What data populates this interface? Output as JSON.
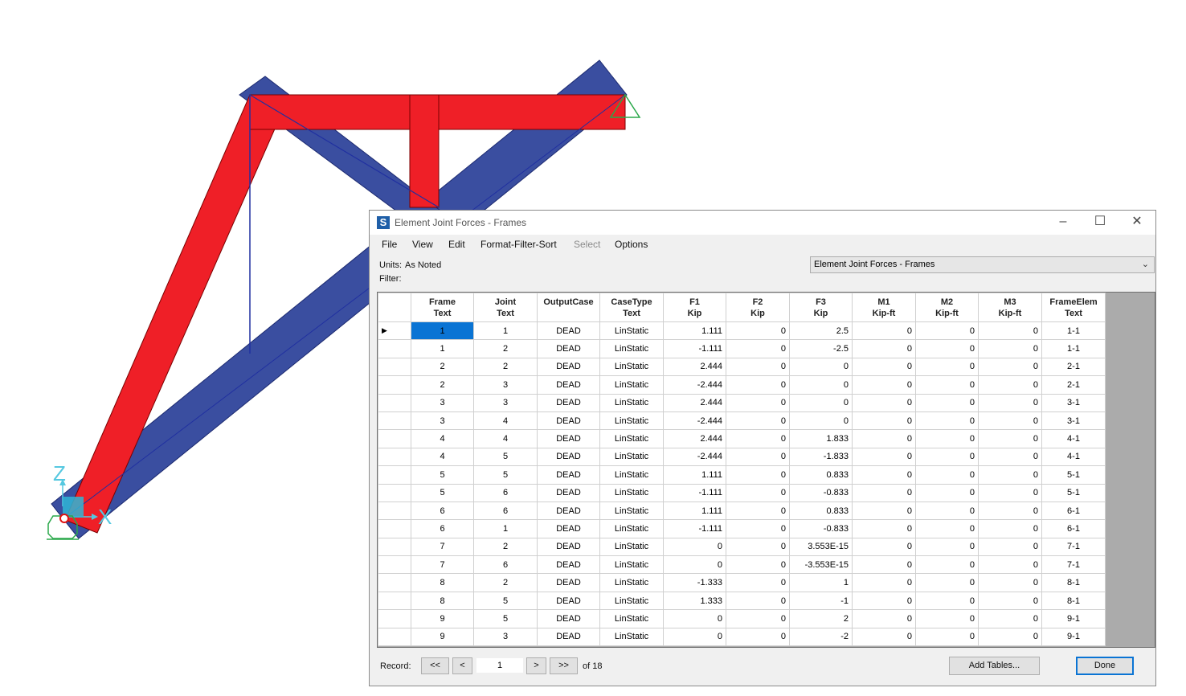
{
  "model_view": {
    "axis_z_label": "Z",
    "axis_x_label": "X"
  },
  "window": {
    "title": "Element Joint Forces - Frames",
    "app_icon": "S",
    "minimize_icon": "minimize-icon",
    "maximize_icon": "maximize-icon",
    "close_icon": "close-icon"
  },
  "menu": [
    "File",
    "View",
    "Edit",
    "Format-Filter-Sort",
    "Select",
    "Options"
  ],
  "menu_disabled": [
    "Select"
  ],
  "info": {
    "units_label": "Units:",
    "units_value": "As Noted",
    "filter_label": "Filter:"
  },
  "table_select": {
    "value": "Element Joint Forces - Frames"
  },
  "table": {
    "headers": [
      {
        "name": "Frame",
        "unit": "Text"
      },
      {
        "name": "Joint",
        "unit": "Text"
      },
      {
        "name": "OutputCase",
        "unit": ""
      },
      {
        "name": "CaseType",
        "unit": "Text"
      },
      {
        "name": "F1",
        "unit": "Kip"
      },
      {
        "name": "F2",
        "unit": "Kip"
      },
      {
        "name": "F3",
        "unit": "Kip"
      },
      {
        "name": "M1",
        "unit": "Kip-ft"
      },
      {
        "name": "M2",
        "unit": "Kip-ft"
      },
      {
        "name": "M3",
        "unit": "Kip-ft"
      },
      {
        "name": "FrameElem",
        "unit": "Text"
      }
    ],
    "rows": [
      [
        "1",
        "1",
        "DEAD",
        "LinStatic",
        "1.111",
        "0",
        "2.5",
        "0",
        "0",
        "0",
        "1-1"
      ],
      [
        "1",
        "2",
        "DEAD",
        "LinStatic",
        "-1.111",
        "0",
        "-2.5",
        "0",
        "0",
        "0",
        "1-1"
      ],
      [
        "2",
        "2",
        "DEAD",
        "LinStatic",
        "2.444",
        "0",
        "0",
        "0",
        "0",
        "0",
        "2-1"
      ],
      [
        "2",
        "3",
        "DEAD",
        "LinStatic",
        "-2.444",
        "0",
        "0",
        "0",
        "0",
        "0",
        "2-1"
      ],
      [
        "3",
        "3",
        "DEAD",
        "LinStatic",
        "2.444",
        "0",
        "0",
        "0",
        "0",
        "0",
        "3-1"
      ],
      [
        "3",
        "4",
        "DEAD",
        "LinStatic",
        "-2.444",
        "0",
        "0",
        "0",
        "0",
        "0",
        "3-1"
      ],
      [
        "4",
        "4",
        "DEAD",
        "LinStatic",
        "2.444",
        "0",
        "1.833",
        "0",
        "0",
        "0",
        "4-1"
      ],
      [
        "4",
        "5",
        "DEAD",
        "LinStatic",
        "-2.444",
        "0",
        "-1.833",
        "0",
        "0",
        "0",
        "4-1"
      ],
      [
        "5",
        "5",
        "DEAD",
        "LinStatic",
        "1.111",
        "0",
        "0.833",
        "0",
        "0",
        "0",
        "5-1"
      ],
      [
        "5",
        "6",
        "DEAD",
        "LinStatic",
        "-1.111",
        "0",
        "-0.833",
        "0",
        "0",
        "0",
        "5-1"
      ],
      [
        "6",
        "6",
        "DEAD",
        "LinStatic",
        "1.111",
        "0",
        "0.833",
        "0",
        "0",
        "0",
        "6-1"
      ],
      [
        "6",
        "1",
        "DEAD",
        "LinStatic",
        "-1.111",
        "0",
        "-0.833",
        "0",
        "0",
        "0",
        "6-1"
      ],
      [
        "7",
        "2",
        "DEAD",
        "LinStatic",
        "0",
        "0",
        "3.553E-15",
        "0",
        "0",
        "0",
        "7-1"
      ],
      [
        "7",
        "6",
        "DEAD",
        "LinStatic",
        "0",
        "0",
        "-3.553E-15",
        "0",
        "0",
        "0",
        "7-1"
      ],
      [
        "8",
        "2",
        "DEAD",
        "LinStatic",
        "-1.333",
        "0",
        "1",
        "0",
        "0",
        "0",
        "8-1"
      ],
      [
        "8",
        "5",
        "DEAD",
        "LinStatic",
        "1.333",
        "0",
        "-1",
        "0",
        "0",
        "0",
        "8-1"
      ],
      [
        "9",
        "5",
        "DEAD",
        "LinStatic",
        "0",
        "0",
        "2",
        "0",
        "0",
        "0",
        "9-1"
      ],
      [
        "9",
        "3",
        "DEAD",
        "LinStatic",
        "0",
        "0",
        "-2",
        "0",
        "0",
        "0",
        "9-1"
      ]
    ],
    "row_pointer": "▶"
  },
  "record_nav": {
    "label": "Record:",
    "first": "<<",
    "prev": "<",
    "value": "1",
    "next": ">",
    "last": ">>",
    "of_text": "of 18"
  },
  "buttons": {
    "add_tables": "Add Tables...",
    "done": "Done"
  },
  "colors": {
    "member_red": "#ef1f27",
    "member_blue": "#3a4ea0",
    "selection_blue": "#0a74d4",
    "support_green": "#2aa84a",
    "axis_cyan": "#55c8e0"
  }
}
